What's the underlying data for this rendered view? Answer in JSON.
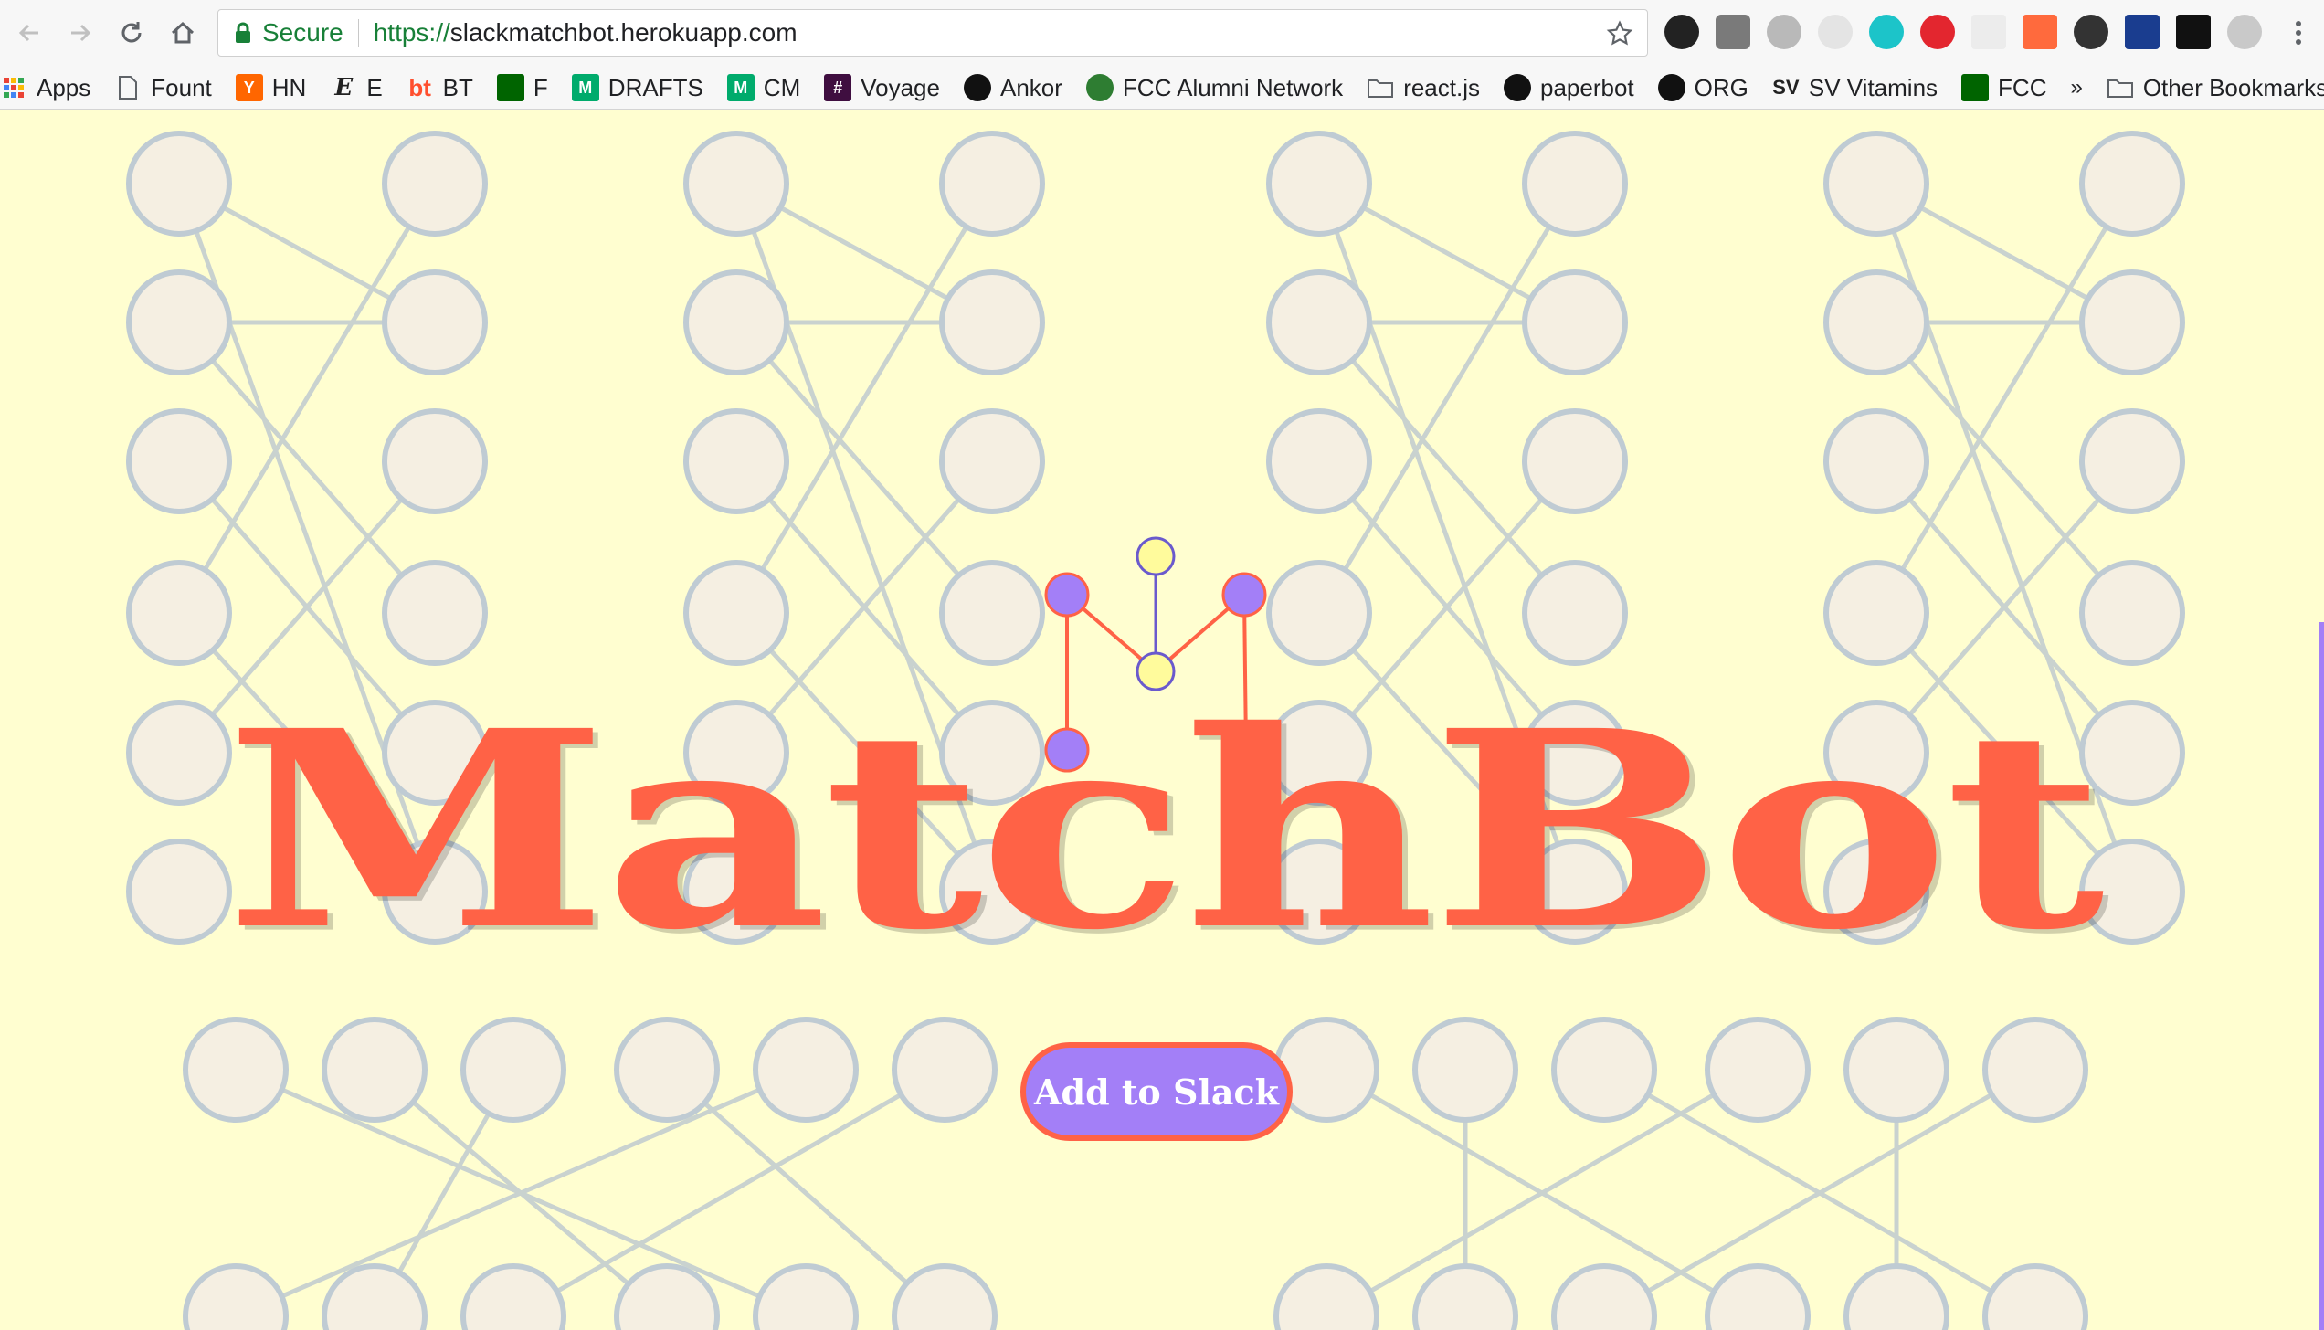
{
  "browser": {
    "secure_label": "Secure",
    "url_scheme": "https://",
    "url_host": "slackmatchbot.herokuapp.com",
    "bookmarks": [
      {
        "label": "Apps",
        "icon": "apps-grid-icon"
      },
      {
        "label": "Fount",
        "icon": "page-icon"
      },
      {
        "label": "HN",
        "icon": "hn-icon",
        "color": "#ff6600"
      },
      {
        "label": "E",
        "icon": "e-icon"
      },
      {
        "label": "BT",
        "icon": "bt-icon",
        "color": "#ff4f2e"
      },
      {
        "label": "F",
        "icon": "fcc-icon",
        "color": "#006400"
      },
      {
        "label": "DRAFTS",
        "icon": "medium-icon",
        "color": "#00ab6c"
      },
      {
        "label": "CM",
        "icon": "medium-icon",
        "color": "#00ab6c"
      },
      {
        "label": "Voyage",
        "icon": "slack-hash-icon",
        "color": "#e01e5a"
      },
      {
        "label": "Ankor",
        "icon": "github-icon"
      },
      {
        "label": "FCC Alumni Network",
        "icon": "alumni-icon",
        "color": "#2e7d32"
      },
      {
        "label": "react.js",
        "icon": "folder-icon"
      },
      {
        "label": "paperbot",
        "icon": "target-icon"
      },
      {
        "label": "ORG",
        "icon": "github-icon"
      },
      {
        "label": "SV Vitamins",
        "icon": "sv-icon"
      },
      {
        "label": "FCC",
        "icon": "fcc-icon",
        "color": "#006400"
      }
    ],
    "overflow_label": "»",
    "other_bookmarks": "Other Bookmarks"
  },
  "page": {
    "title": "MatchBot",
    "add_button_label": "Add to Slack",
    "colors": {
      "background": "#fffed0",
      "accent": "#ff6246",
      "purple": "#a37ff7",
      "node_fill": "#f5efe2",
      "node_stroke": "#bfcbd3"
    }
  }
}
